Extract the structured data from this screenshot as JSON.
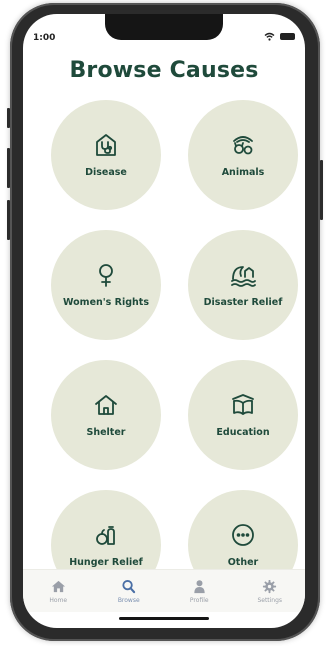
{
  "status_bar": {
    "time": "1:00"
  },
  "page": {
    "title": "Browse Causes"
  },
  "causes": [
    {
      "label": "Disease",
      "icon": "medical-house-icon"
    },
    {
      "label": "Animals",
      "icon": "pets-icon"
    },
    {
      "label": "Women's Rights",
      "icon": "female-symbol-icon"
    },
    {
      "label": "Disaster Relief",
      "icon": "flood-icon"
    },
    {
      "label": "Shelter",
      "icon": "house-icon"
    },
    {
      "label": "Education",
      "icon": "open-book-icon"
    },
    {
      "label": "Hunger Relief",
      "icon": "groceries-icon"
    },
    {
      "label": "Other",
      "icon": "more-dots-icon"
    }
  ],
  "tabbar": {
    "home": "Home",
    "browse": "Browse",
    "profile": "Profile",
    "settings": "Settings",
    "active": "browse"
  },
  "colors": {
    "primary": "#1f4a3b",
    "tile_bg": "#e6e8d8",
    "tab_inactive": "#9a9fa8",
    "tab_active": "#4a6fa5"
  }
}
